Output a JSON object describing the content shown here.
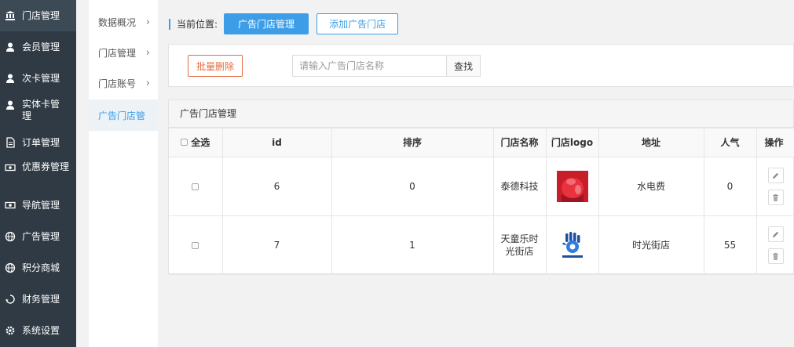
{
  "sidebar": {
    "items": [
      {
        "label": "门店管理",
        "icon": "bank-icon",
        "active": true
      },
      {
        "label": "会员管理",
        "icon": "user-icon"
      },
      {
        "label": "次卡管理",
        "icon": "user-icon"
      },
      {
        "label": "实体卡管理",
        "icon": "user-icon"
      },
      {
        "label": "订单管理",
        "icon": "document-icon"
      },
      {
        "label": "优惠券管理",
        "icon": "money-icon"
      },
      {
        "label": "导航管理",
        "icon": "money-icon"
      },
      {
        "label": "广告管理",
        "icon": "globe-icon"
      },
      {
        "label": "积分商城",
        "icon": "globe-icon"
      },
      {
        "label": "财务管理",
        "icon": "recycle-icon"
      },
      {
        "label": "系统设置",
        "icon": "gear-icon"
      }
    ]
  },
  "subnav": {
    "items": [
      {
        "label": "数据概况",
        "chevron": "›"
      },
      {
        "label": "门店管理",
        "chevron": "›"
      },
      {
        "label": "门店账号",
        "chevron": "›"
      },
      {
        "label": "广告门店管",
        "active": true
      }
    ]
  },
  "breadcrumb": {
    "label": "当前位置:",
    "current_button": "广告门店管理",
    "add_button": "添加广告门店"
  },
  "toolbar": {
    "batch_delete": "批量删除",
    "search_placeholder": "请输入广告门店名称",
    "search_button": "查找"
  },
  "panel": {
    "title": "广告门店管理"
  },
  "table": {
    "select_all": "全选",
    "headers": {
      "id": "id",
      "sort": "排序",
      "name": "门店名称",
      "logo": "门店logo",
      "address": "地址",
      "popularity": "人气",
      "actions": "操作"
    },
    "rows": [
      {
        "id": "6",
        "sort": "0",
        "name": "泰德科技",
        "logo": "red-photo-thumbnail",
        "address": "水电费",
        "popularity": "0"
      },
      {
        "id": "7",
        "sort": "1",
        "name": "天童乐时光街店",
        "logo": "blue-hand-logo-thumbnail",
        "address": "时光街店",
        "popularity": "55"
      }
    ]
  },
  "colors": {
    "sidebar_bg": "#2f3a44",
    "accent": "#3d9ee7",
    "danger": "#e86a3d"
  }
}
